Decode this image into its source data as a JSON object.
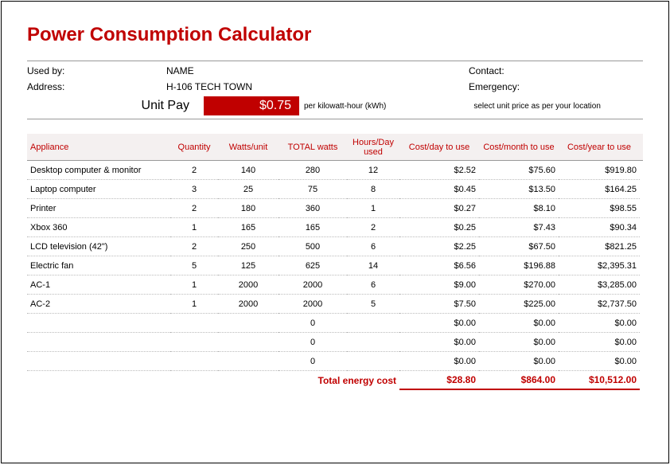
{
  "title": "Power Consumption Calculator",
  "info": {
    "used_by_label": "Used by:",
    "used_by_value": "NAME",
    "address_label": "Address:",
    "address_value": "H-106 TECH TOWN",
    "contact_label": "Contact:",
    "emergency_label": "Emergency:",
    "unit_pay_label": "Unit Pay",
    "unit_pay_value": "$0.75",
    "unit_pay_note": "per kilowatt-hour (kWh)",
    "unit_pay_right": "select unit price as per your location"
  },
  "columns": {
    "appliance": "Appliance",
    "quantity": "Quantity",
    "watts_unit": "Watts/unit",
    "total_watts": "TOTAL  watts",
    "hours_day": "Hours/Day used",
    "cost_day": "Cost/day to use",
    "cost_month": "Cost/month to use",
    "cost_year": "Cost/year to use"
  },
  "rows": [
    {
      "appliance": "Desktop computer & monitor",
      "qty": "2",
      "wu": "140",
      "tw": "280",
      "hd": "12",
      "cd": "$2.52",
      "cm": "$75.60",
      "cy": "$919.80"
    },
    {
      "appliance": "Laptop computer",
      "qty": "3",
      "wu": "25",
      "tw": "75",
      "hd": "8",
      "cd": "$0.45",
      "cm": "$13.50",
      "cy": "$164.25"
    },
    {
      "appliance": "Printer",
      "qty": "2",
      "wu": "180",
      "tw": "360",
      "hd": "1",
      "cd": "$0.27",
      "cm": "$8.10",
      "cy": "$98.55"
    },
    {
      "appliance": "Xbox 360",
      "qty": "1",
      "wu": "165",
      "tw": "165",
      "hd": "2",
      "cd": "$0.25",
      "cm": "$7.43",
      "cy": "$90.34"
    },
    {
      "appliance": "LCD television (42\")",
      "qty": "2",
      "wu": "250",
      "tw": "500",
      "hd": "6",
      "cd": "$2.25",
      "cm": "$67.50",
      "cy": "$821.25"
    },
    {
      "appliance": "Electric fan",
      "qty": "5",
      "wu": "125",
      "tw": "625",
      "hd": "14",
      "cd": "$6.56",
      "cm": "$196.88",
      "cy": "$2,395.31"
    },
    {
      "appliance": "AC-1",
      "qty": "1",
      "wu": "2000",
      "tw": "2000",
      "hd": "6",
      "cd": "$9.00",
      "cm": "$270.00",
      "cy": "$3,285.00"
    },
    {
      "appliance": "AC-2",
      "qty": "1",
      "wu": "2000",
      "tw": "2000",
      "hd": "5",
      "cd": "$7.50",
      "cm": "$225.00",
      "cy": "$2,737.50"
    },
    {
      "appliance": "",
      "qty": "",
      "wu": "",
      "tw": "0",
      "hd": "",
      "cd": "$0.00",
      "cm": "$0.00",
      "cy": "$0.00"
    },
    {
      "appliance": "",
      "qty": "",
      "wu": "",
      "tw": "0",
      "hd": "",
      "cd": "$0.00",
      "cm": "$0.00",
      "cy": "$0.00"
    },
    {
      "appliance": "",
      "qty": "",
      "wu": "",
      "tw": "0",
      "hd": "",
      "cd": "$0.00",
      "cm": "$0.00",
      "cy": "$0.00"
    }
  ],
  "totals": {
    "label": "Total energy cost",
    "cd": "$28.80",
    "cm": "$864.00",
    "cy": "$10,512.00"
  },
  "chart_data": {
    "type": "table",
    "title": "Power Consumption Calculator",
    "unit_price_per_kwh": 0.75,
    "columns": [
      "Appliance",
      "Quantity",
      "Watts/unit",
      "TOTAL watts",
      "Hours/Day used",
      "Cost/day to use",
      "Cost/month to use",
      "Cost/year to use"
    ],
    "rows": [
      [
        "Desktop computer & monitor",
        2,
        140,
        280,
        12,
        2.52,
        75.6,
        919.8
      ],
      [
        "Laptop computer",
        3,
        25,
        75,
        8,
        0.45,
        13.5,
        164.25
      ],
      [
        "Printer",
        2,
        180,
        360,
        1,
        0.27,
        8.1,
        98.55
      ],
      [
        "Xbox 360",
        1,
        165,
        165,
        2,
        0.25,
        7.43,
        90.34
      ],
      [
        "LCD television (42\")",
        2,
        250,
        500,
        6,
        2.25,
        67.5,
        821.25
      ],
      [
        "Electric fan",
        5,
        125,
        625,
        14,
        6.56,
        196.88,
        2395.31
      ],
      [
        "AC-1",
        1,
        2000,
        2000,
        6,
        9.0,
        270.0,
        3285.0
      ],
      [
        "AC-2",
        1,
        2000,
        2000,
        5,
        7.5,
        225.0,
        2737.5
      ]
    ],
    "totals": {
      "cost_day": 28.8,
      "cost_month": 864.0,
      "cost_year": 10512.0
    }
  }
}
